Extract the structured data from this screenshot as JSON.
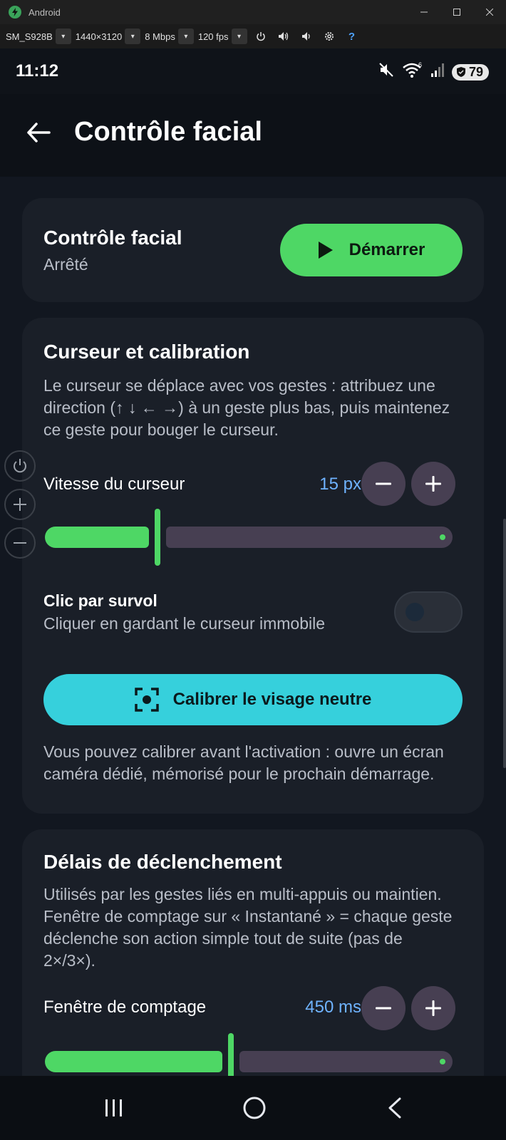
{
  "window": {
    "title": "Android",
    "controls": [
      "minimize",
      "maximize",
      "close"
    ]
  },
  "toolbar": {
    "device": "SM_S928B",
    "resolution": "1440×3120",
    "bitrate": "8 Mbps",
    "fps": "120 fps",
    "help": "?"
  },
  "status": {
    "time": "11:12",
    "battery": "79"
  },
  "appbar": {
    "title": "Contrôle facial"
  },
  "control_card": {
    "title": "Contrôle facial",
    "state": "Arrêté",
    "start_label": "Démarrer"
  },
  "cursor_card": {
    "title": "Curseur et calibration",
    "description": "Le curseur se déplace avec vos gestes : attribuez une direction (↑ ↓ ← →) à un geste plus bas, puis maintenez ce geste pour bouger le curseur.",
    "speed_label": "Vitesse du curseur",
    "speed_value": "15 px",
    "speed_fraction": 0.27,
    "hover_click_title": "Clic par survol",
    "hover_click_desc": "Cliquer en gardant le curseur immobile",
    "hover_click_enabled": false,
    "calibrate_label": "Calibrer le visage neutre",
    "calibrate_note": "Vous pouvez calibrer avant l'activation : ouvre un écran caméra dédié, mémorisé pour le prochain démarrage."
  },
  "delay_card": {
    "title": "Délais de déclenchement",
    "description": "Utilisés par les gestes liés en multi-appuis ou maintien. Fenêtre de comptage sur « Instantané » = chaque geste déclenche son action simple tout de suite (pas de 2×/3×).",
    "window_label": "Fenêtre de comptage",
    "window_value": "450 ms",
    "window_fraction": 0.45
  },
  "colors": {
    "accent_green": "#4ed765",
    "accent_cyan": "#36d0dc",
    "value_blue": "#6fb3ff",
    "card_bg": "#1a1f28"
  }
}
